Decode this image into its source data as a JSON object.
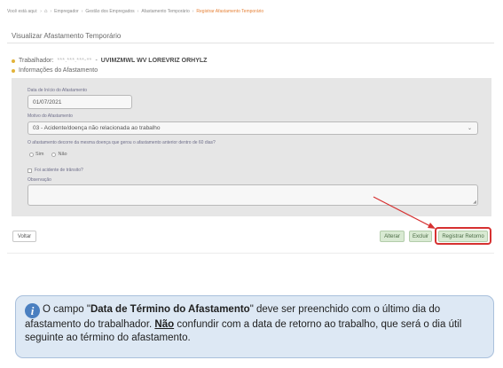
{
  "breadcrumb": {
    "prefix": "Você está aqui:",
    "items": [
      "Empregador",
      "Gestão dos Empregados",
      "Afastamento Temporário"
    ],
    "current": "Registrar Afastamento Temporário"
  },
  "page": {
    "title": "Visualizar Afastamento Temporário"
  },
  "worker": {
    "label": "Trabalhador:",
    "cpf": "***.***.***-**",
    "separator": " - ",
    "name": "UVIMZMWL WV LOREVRIZ ORHYLZ"
  },
  "section": {
    "title": "Informações do Afastamento"
  },
  "form": {
    "start_date_label": "Data de Início do Afastamento",
    "start_date_value": "01/07/2021",
    "motivo_label": "Motivo do Afastamento",
    "motivo_value": "03 - Acidente/doença não relacionada ao trabalho",
    "question_label": "O afastamento decorre da mesma doença que gerou o afastamento anterior dentro de 60 dias?",
    "radio_yes": "Sim",
    "radio_no": "Não",
    "checkbox_label": "Foi acidente de trânsito?",
    "obs_label": "Observação",
    "obs_value": ""
  },
  "buttons": {
    "voltar": "Voltar",
    "alterar": "Alterar",
    "excluir": "Excluir",
    "registrar": "Registrar Retorno"
  },
  "note": {
    "part1": "O campo \"",
    "field": "Data de Término do Afastamento",
    "part2": "\" deve ser preenchido com o último dia do afastamento do trabalhador. ",
    "nao": "Não",
    "part3": " confundir com a data de retorno ao trabalho, que será o dia útil seguinte ao término do afastamento."
  },
  "colors": {
    "highlight": "#d63131",
    "bullet": "#e2b33a",
    "breadcrumb_current": "#e6833a",
    "note_bg": "#dde8f4",
    "info_icon": "#4a7fc0"
  },
  "icons": {
    "home": "home-icon",
    "info": "info-icon",
    "dropdown": "chevron-down-icon"
  }
}
